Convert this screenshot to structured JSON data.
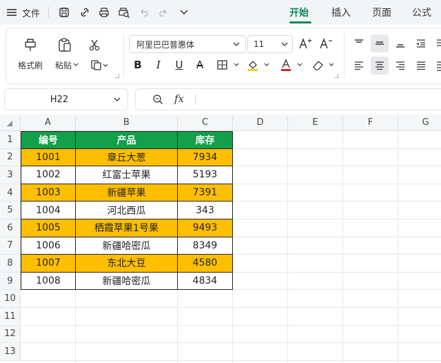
{
  "titlebar": {
    "file_label": "文件",
    "tabs": [
      {
        "label": "开始",
        "active": true
      },
      {
        "label": "插入",
        "active": false
      },
      {
        "label": "页面",
        "active": false
      },
      {
        "label": "公式",
        "active": false
      }
    ]
  },
  "ribbon": {
    "format_painter": "格式刷",
    "paste": "粘贴",
    "font_name": "阿里巴巴普惠体",
    "font_size": "11"
  },
  "formula_bar": {
    "name_box": "H22",
    "fx": "fx",
    "value": ""
  },
  "sheet": {
    "columns": [
      "A",
      "B",
      "C",
      "D",
      "E",
      "F",
      "G"
    ],
    "rows": [
      "1",
      "2",
      "3",
      "4",
      "5",
      "6",
      "7",
      "8",
      "9",
      "10",
      "11",
      "12",
      "13"
    ],
    "header": [
      "编号",
      "产品",
      "库存"
    ],
    "data": [
      [
        "1001",
        "章丘大葱",
        "7934"
      ],
      [
        "1002",
        "红富士苹果",
        "5193"
      ],
      [
        "1003",
        "新疆苹果",
        "7391"
      ],
      [
        "1004",
        "河北西瓜",
        "343"
      ],
      [
        "1005",
        "栖霞苹果1号果",
        "9493"
      ],
      [
        "1006",
        "新疆哈密瓜",
        "8349"
      ],
      [
        "1007",
        "东北大豆",
        "4580"
      ],
      [
        "1008",
        "新疆哈密瓜",
        "4834"
      ]
    ],
    "highlighted_rows": [
      0,
      2,
      4,
      6
    ]
  },
  "colors": {
    "header_green": "#12a04a",
    "highlight_orange": "#ffbf00",
    "accent": "#0a8a5a"
  }
}
